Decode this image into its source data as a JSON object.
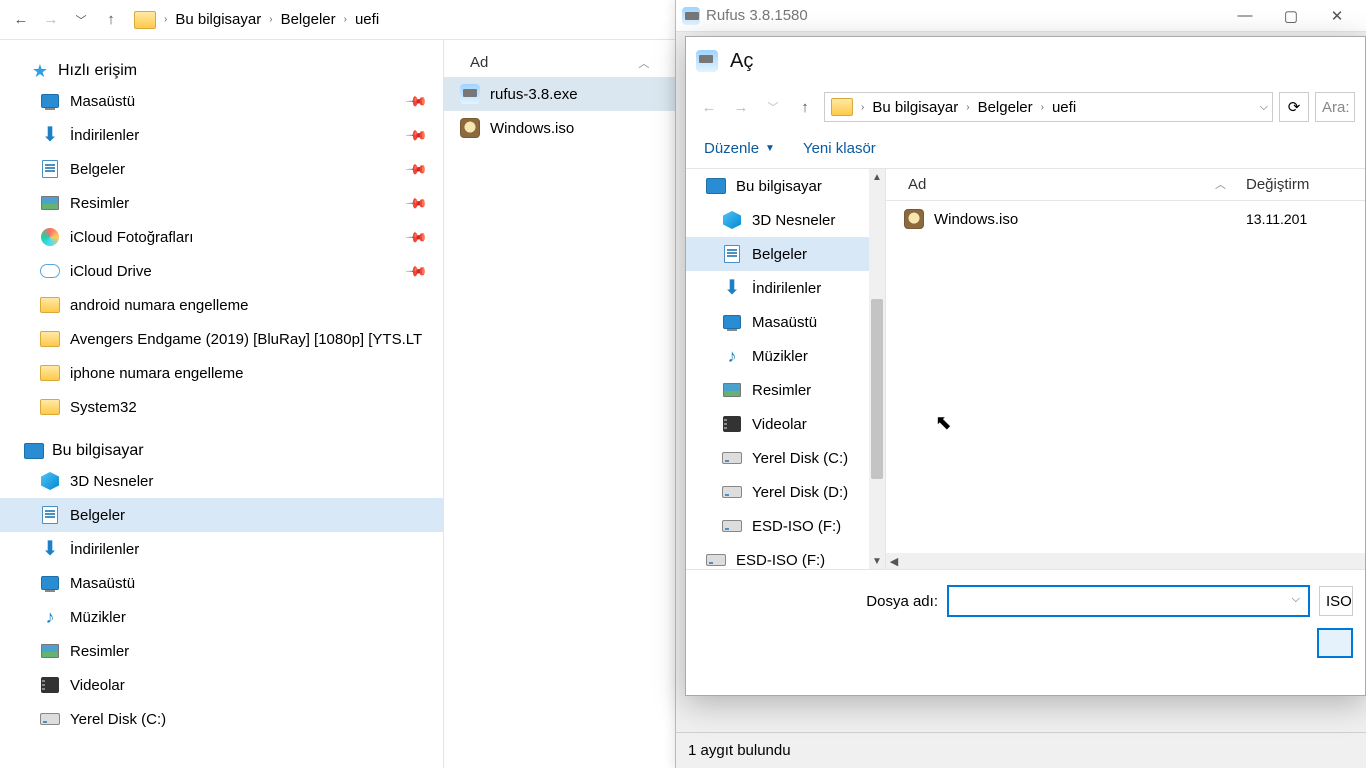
{
  "explorer": {
    "breadcrumbs": [
      "Bu bilgisayar",
      "Belgeler",
      "uefi"
    ],
    "nav": {
      "quick_access": "Hızlı erişim",
      "quick_items": [
        {
          "label": "Masaüstü",
          "icon": "desktop",
          "pin": true
        },
        {
          "label": "İndirilenler",
          "icon": "download",
          "pin": true
        },
        {
          "label": "Belgeler",
          "icon": "doc",
          "pin": true
        },
        {
          "label": "Resimler",
          "icon": "pic",
          "pin": true
        },
        {
          "label": "iCloud Fotoğrafları",
          "icon": "icloud-photo",
          "pin": true
        },
        {
          "label": "iCloud Drive",
          "icon": "icloud",
          "pin": true
        },
        {
          "label": "android numara engelleme",
          "icon": "folder"
        },
        {
          "label": "Avengers Endgame (2019) [BluRay] [1080p] [YTS.LT",
          "icon": "folder"
        },
        {
          "label": "iphone numara engelleme",
          "icon": "folder"
        },
        {
          "label": "System32",
          "icon": "folder"
        }
      ],
      "this_pc": "Bu bilgisayar",
      "pc_items": [
        {
          "label": "3D Nesneler",
          "icon": "3d"
        },
        {
          "label": "Belgeler",
          "icon": "doc",
          "selected": true
        },
        {
          "label": "İndirilenler",
          "icon": "download"
        },
        {
          "label": "Masaüstü",
          "icon": "desktop"
        },
        {
          "label": "Müzikler",
          "icon": "music"
        },
        {
          "label": "Resimler",
          "icon": "pic"
        },
        {
          "label": "Videolar",
          "icon": "video"
        },
        {
          "label": "Yerel Disk (C:)",
          "icon": "drive"
        }
      ]
    },
    "list": {
      "col_name": "Ad",
      "files": [
        {
          "name": "rufus-3.8.exe",
          "icon": "rufus",
          "selected": true
        },
        {
          "name": "Windows.iso",
          "icon": "iso"
        }
      ]
    }
  },
  "rufus": {
    "title": "Rufus 3.8.1580",
    "status": "1 aygıt bulundu"
  },
  "dialog": {
    "title": "Aç",
    "breadcrumbs": [
      "Bu bilgisayar",
      "Belgeler",
      "uefi"
    ],
    "search_placeholder": "Ara:",
    "toolbar": {
      "organize": "Düzenle",
      "new_folder": "Yeni klasör"
    },
    "nav_items": [
      {
        "label": "Bu bilgisayar",
        "icon": "pc",
        "lvl": 1
      },
      {
        "label": "3D Nesneler",
        "icon": "3d",
        "lvl": 2
      },
      {
        "label": "Belgeler",
        "icon": "doc",
        "lvl": 2,
        "selected": true
      },
      {
        "label": "İndirilenler",
        "icon": "download",
        "lvl": 2
      },
      {
        "label": "Masaüstü",
        "icon": "desktop",
        "lvl": 2
      },
      {
        "label": "Müzikler",
        "icon": "music",
        "lvl": 2
      },
      {
        "label": "Resimler",
        "icon": "pic",
        "lvl": 2
      },
      {
        "label": "Videolar",
        "icon": "video",
        "lvl": 2
      },
      {
        "label": "Yerel Disk (C:)",
        "icon": "drive",
        "lvl": 2
      },
      {
        "label": "Yerel Disk (D:)",
        "icon": "drive",
        "lvl": 2
      },
      {
        "label": "ESD-ISO (F:)",
        "icon": "drive",
        "lvl": 2
      },
      {
        "label": "ESD-ISO (F:)",
        "icon": "drive",
        "lvl": 1
      }
    ],
    "cols": {
      "name": "Ad",
      "modified": "Değiştirm"
    },
    "files": [
      {
        "name": "Windows.iso",
        "modified": "13.11.201",
        "icon": "iso"
      }
    ],
    "filename_label": "Dosya adı:",
    "filter": "ISO"
  }
}
